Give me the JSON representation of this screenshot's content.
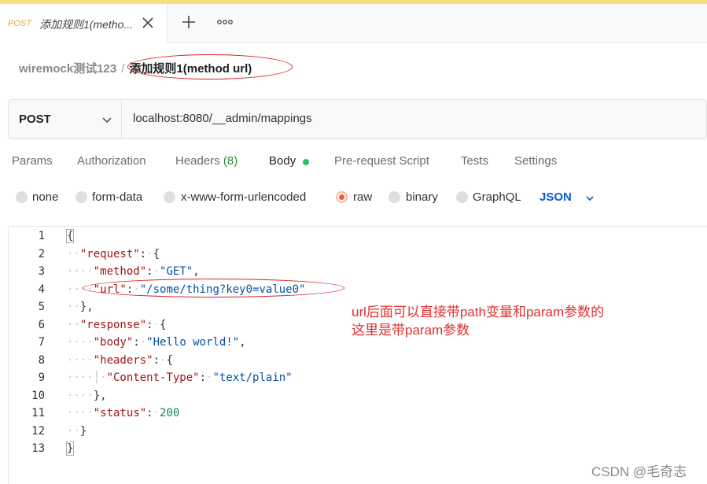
{
  "tab": {
    "method": "POST",
    "title": "添加规则1(metho..."
  },
  "breadcrumb": {
    "parent": "wiremock测试123",
    "separator": "/",
    "current": "添加规则1(method url)"
  },
  "request": {
    "method": "POST",
    "url": "localhost:8080/__admin/mappings"
  },
  "request_tabs": [
    {
      "label": "Params"
    },
    {
      "label": "Authorization"
    },
    {
      "label": "Headers",
      "count": "(8)"
    },
    {
      "label": "Body"
    },
    {
      "label": "Pre-request Script"
    },
    {
      "label": "Tests"
    },
    {
      "label": "Settings"
    }
  ],
  "body_types": [
    {
      "label": "none"
    },
    {
      "label": "form-data"
    },
    {
      "label": "x-www-form-urlencoded"
    },
    {
      "label": "raw",
      "selected": true
    },
    {
      "label": "binary"
    },
    {
      "label": "GraphQL"
    }
  ],
  "format": "JSON",
  "editor": {
    "line_numbers": [
      "1",
      "2",
      "3",
      "4",
      "5",
      "6",
      "7",
      "8",
      "9",
      "10",
      "11",
      "12",
      "13"
    ],
    "tokens": {
      "open": "{",
      "close": "}",
      "close_comma": "},",
      "key_request": "\"request\"",
      "key_method": "\"method\"",
      "val_method": "\"GET\"",
      "key_url": "\"url\"",
      "val_url": "\"/some/thing?key0=value0\"",
      "key_response": "\"response\"",
      "key_body": "\"body\"",
      "val_body": "\"Hello world!\"",
      "key_headers": "\"headers\"",
      "key_content_type": "\"Content-Type\"",
      "val_content_type": "\"text/plain\"",
      "key_status": "\"status\"",
      "val_status": "200"
    }
  },
  "annotation": {
    "line1": "url后面可以直接带path变量和param参数的",
    "line2": "这里是带param参数"
  },
  "watermark": "CSDN @毛奇志",
  "colors": {
    "accent_post": "#e8a43c",
    "annotation_red": "#e03131",
    "json_blue": "#0a5bd6",
    "radio_orange": "#ef5b25",
    "body_dot_green": "#22c55e"
  }
}
